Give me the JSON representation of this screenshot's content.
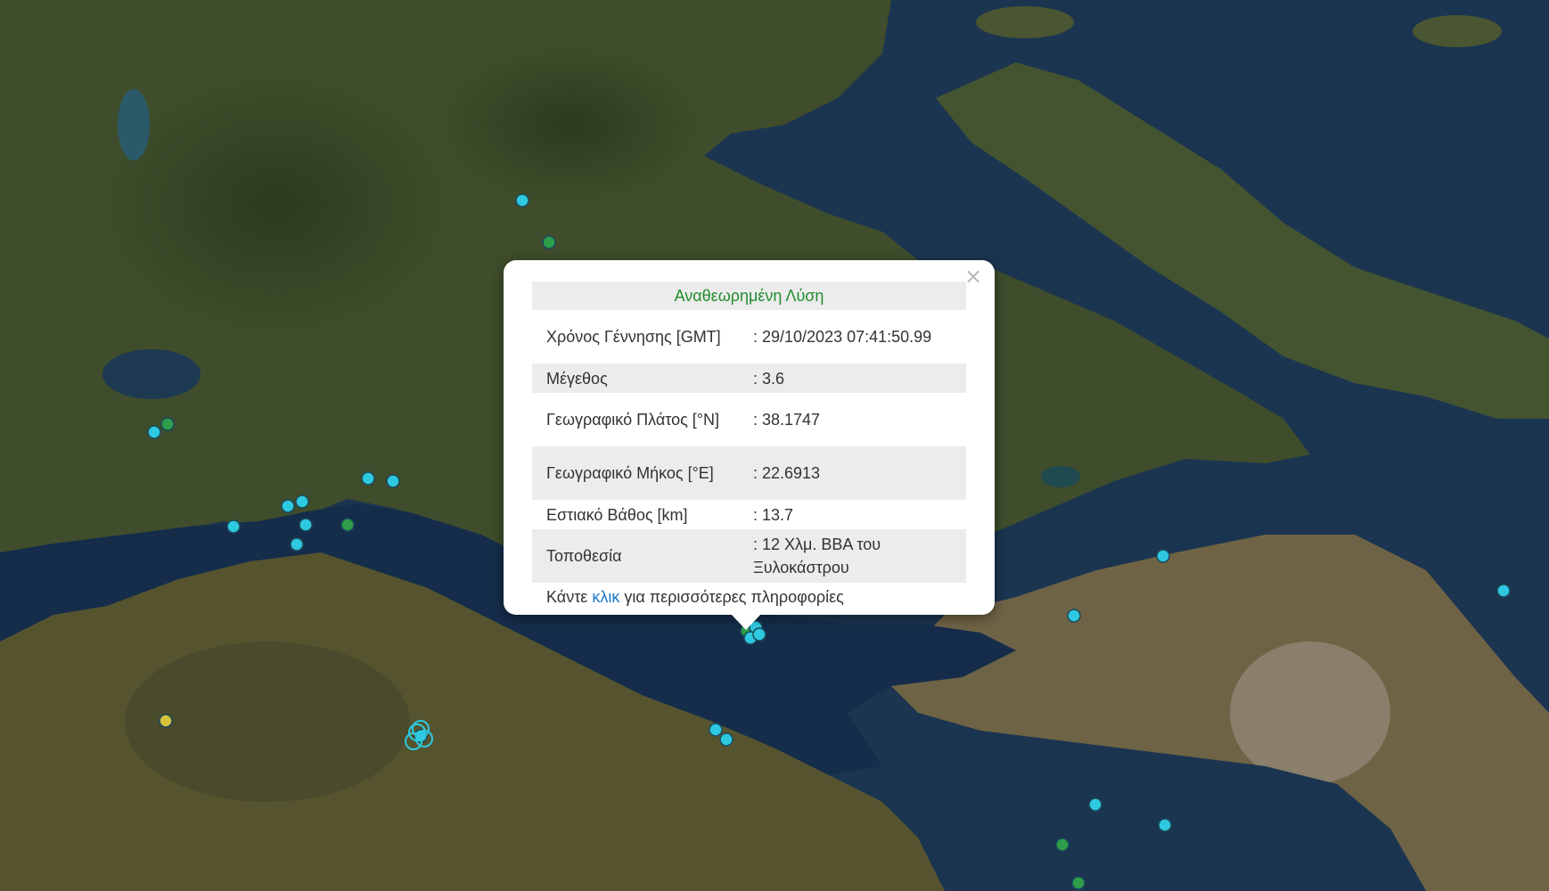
{
  "map": {
    "type": "satellite",
    "colors": {
      "sea": "#1b3550",
      "land": "#3d4c2a",
      "quake_cyan": "#2ec9e0",
      "quake_green": "#2e9e4a",
      "quake_yellow": "#d8c23a"
    },
    "markers": [
      {
        "id": "m1",
        "color": "cyan"
      },
      {
        "id": "m2",
        "color": "green"
      },
      {
        "id": "m3",
        "color": "cyan"
      },
      {
        "id": "m4",
        "color": "green"
      },
      {
        "id": "m5",
        "color": "cyan"
      },
      {
        "id": "m6",
        "color": "cyan"
      },
      {
        "id": "m7",
        "color": "cyan"
      },
      {
        "id": "m8",
        "color": "cyan"
      },
      {
        "id": "m9",
        "color": "cyan"
      },
      {
        "id": "m10",
        "color": "cyan"
      },
      {
        "id": "m11",
        "color": "green"
      },
      {
        "id": "m12",
        "color": "cyan"
      },
      {
        "id": "m13",
        "color": "yellow"
      },
      {
        "id": "m14",
        "color": "cyan"
      },
      {
        "id": "m15",
        "color": "cyan"
      },
      {
        "id": "m16",
        "color": "cyan"
      },
      {
        "id": "m17",
        "color": "green"
      },
      {
        "id": "m18",
        "color": "cyan"
      },
      {
        "id": "m19",
        "color": "cyan"
      },
      {
        "id": "m20",
        "color": "cyan"
      },
      {
        "id": "m21",
        "color": "green"
      },
      {
        "id": "m22",
        "color": "cyan"
      },
      {
        "id": "m23",
        "color": "cyan"
      },
      {
        "id": "m24",
        "color": "green"
      }
    ]
  },
  "popup": {
    "title": "Αναθεωρημένη Λύση",
    "close_icon": "×",
    "rows": [
      {
        "label": "Χρόνος Γέννησης [GMT]",
        "value": ": 29/10/2023 07:41:50.99"
      },
      {
        "label": "Μέγεθος",
        "value": ": 3.6"
      },
      {
        "label": "Γεωγραφικό Πλάτος [°N]",
        "value": ": 38.1747"
      },
      {
        "label": "Γεωγραφικό Μήκος [°E]",
        "value": ": 22.6913"
      },
      {
        "label": "Εστιακό Βάθος [km]",
        "value": ": 13.7"
      },
      {
        "label": "Τοποθεσία",
        "value": ": 12 Χλμ. ΒΒΑ του Ξυλοκάστρου"
      }
    ],
    "footer": {
      "before": "Κάντε ",
      "link": "κλικ",
      "after": " για περισσότερες πληροφορίες"
    }
  }
}
